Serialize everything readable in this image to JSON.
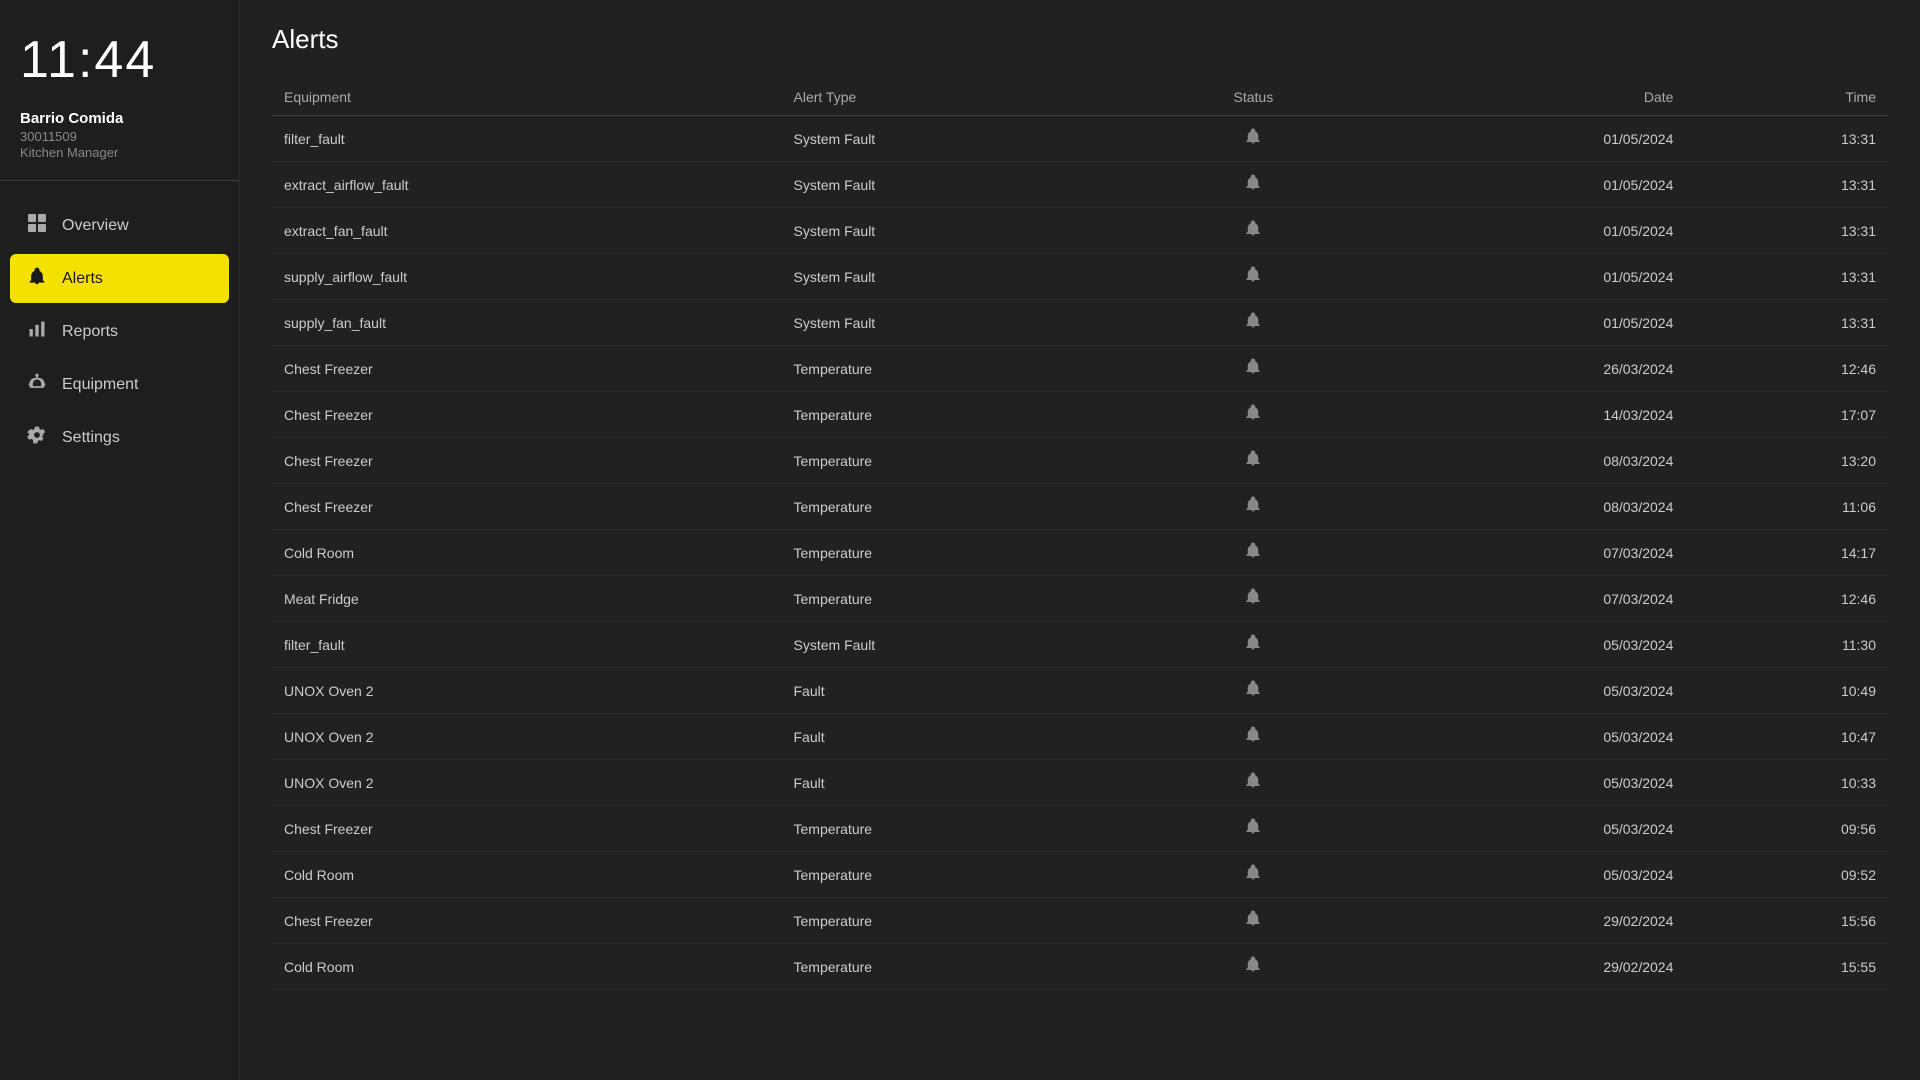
{
  "clock": "11:44",
  "user": {
    "name": "Barrio Comida",
    "id": "30011509",
    "role": "Kitchen Manager"
  },
  "nav": {
    "items": [
      {
        "id": "overview",
        "label": "Overview",
        "icon": "⊞",
        "active": false
      },
      {
        "id": "alerts",
        "label": "Alerts",
        "icon": "🔔",
        "active": true
      },
      {
        "id": "reports",
        "label": "Reports",
        "icon": "📊",
        "active": false
      },
      {
        "id": "equipment",
        "label": "Equipment",
        "icon": "⚙",
        "active": false
      },
      {
        "id": "settings",
        "label": "Settings",
        "icon": "⚙",
        "active": false
      }
    ]
  },
  "page": {
    "title": "Alerts"
  },
  "table": {
    "columns": [
      {
        "id": "equipment",
        "label": "Equipment"
      },
      {
        "id": "alert_type",
        "label": "Alert Type"
      },
      {
        "id": "status",
        "label": "Status"
      },
      {
        "id": "date",
        "label": "Date"
      },
      {
        "id": "time",
        "label": "Time"
      }
    ],
    "rows": [
      {
        "equipment": "filter_fault",
        "alert_type": "System Fault",
        "date": "01/05/2024",
        "time": "13:31"
      },
      {
        "equipment": "extract_airflow_fault",
        "alert_type": "System Fault",
        "date": "01/05/2024",
        "time": "13:31"
      },
      {
        "equipment": "extract_fan_fault",
        "alert_type": "System Fault",
        "date": "01/05/2024",
        "time": "13:31"
      },
      {
        "equipment": "supply_airflow_fault",
        "alert_type": "System Fault",
        "date": "01/05/2024",
        "time": "13:31"
      },
      {
        "equipment": "supply_fan_fault",
        "alert_type": "System Fault",
        "date": "01/05/2024",
        "time": "13:31"
      },
      {
        "equipment": "Chest Freezer",
        "alert_type": "Temperature",
        "date": "26/03/2024",
        "time": "12:46"
      },
      {
        "equipment": "Chest Freezer",
        "alert_type": "Temperature",
        "date": "14/03/2024",
        "time": "17:07"
      },
      {
        "equipment": "Chest Freezer",
        "alert_type": "Temperature",
        "date": "08/03/2024",
        "time": "13:20"
      },
      {
        "equipment": "Chest Freezer",
        "alert_type": "Temperature",
        "date": "08/03/2024",
        "time": "11:06"
      },
      {
        "equipment": "Cold Room",
        "alert_type": "Temperature",
        "date": "07/03/2024",
        "time": "14:17"
      },
      {
        "equipment": "Meat Fridge",
        "alert_type": "Temperature",
        "date": "07/03/2024",
        "time": "12:46"
      },
      {
        "equipment": "filter_fault",
        "alert_type": "System Fault",
        "date": "05/03/2024",
        "time": "11:30"
      },
      {
        "equipment": "UNOX Oven 2",
        "alert_type": "Fault",
        "date": "05/03/2024",
        "time": "10:49"
      },
      {
        "equipment": "UNOX Oven 2",
        "alert_type": "Fault",
        "date": "05/03/2024",
        "time": "10:47"
      },
      {
        "equipment": "UNOX Oven 2",
        "alert_type": "Fault",
        "date": "05/03/2024",
        "time": "10:33"
      },
      {
        "equipment": "Chest Freezer",
        "alert_type": "Temperature",
        "date": "05/03/2024",
        "time": "09:56"
      },
      {
        "equipment": "Cold Room",
        "alert_type": "Temperature",
        "date": "05/03/2024",
        "time": "09:52"
      },
      {
        "equipment": "Chest Freezer",
        "alert_type": "Temperature",
        "date": "29/02/2024",
        "time": "15:56"
      },
      {
        "equipment": "Cold Room",
        "alert_type": "Temperature",
        "date": "29/02/2024",
        "time": "15:55"
      }
    ]
  }
}
